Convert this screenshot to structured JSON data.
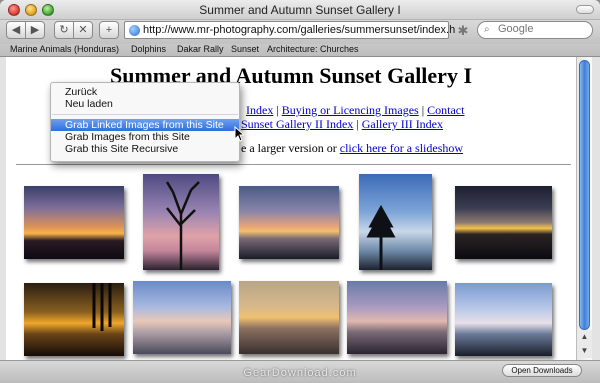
{
  "window": {
    "title": "Summer and Autumn Sunset Gallery I"
  },
  "toolbar": {
    "back_icon": "◀",
    "forward_icon": "▶",
    "reload_icon": "↻",
    "stop_icon": "✕",
    "add_icon": "+",
    "url": "http://www.mr-photography.com/galleries/summersunset/index.h",
    "rss_icon": "✱",
    "search_icon": "⌕",
    "search_placeholder": "Google"
  },
  "bookmarks": [
    "Marine Animals (Honduras)",
    "Dolphins",
    "Dakar Rally",
    "Sunset",
    "Architecture: Churches"
  ],
  "page": {
    "title": "Summer and Autumn Sunset Gallery I",
    "nav1": {
      "index": "Index",
      "sep1": "|",
      "buying": "Buying or Licencing Images",
      "sep2": "|",
      "contact": "Contact"
    },
    "nav2": {
      "gallery2": "Sunset Gallery II Index",
      "sep": "|",
      "gallery3": "Gallery III Index"
    },
    "nav3": {
      "text": "e a larger version or",
      "slideshow": "click here for a slideshow"
    }
  },
  "context_menu": {
    "items": [
      "Zurück",
      "Neu laden",
      "Grab Linked Images from this Site",
      "Grab Images from this Site",
      "Grab this Site Recursive"
    ]
  },
  "scrollbar": {
    "up_icon": "▲",
    "down_icon": "▼"
  },
  "status": {
    "downloads_label": "Open Downloads"
  },
  "watermark": "GearDownload.com",
  "colors": {
    "link": "#0000cc",
    "menu_highlight": "#3a76e0",
    "scroll_thumb": "#3f7fd8"
  }
}
